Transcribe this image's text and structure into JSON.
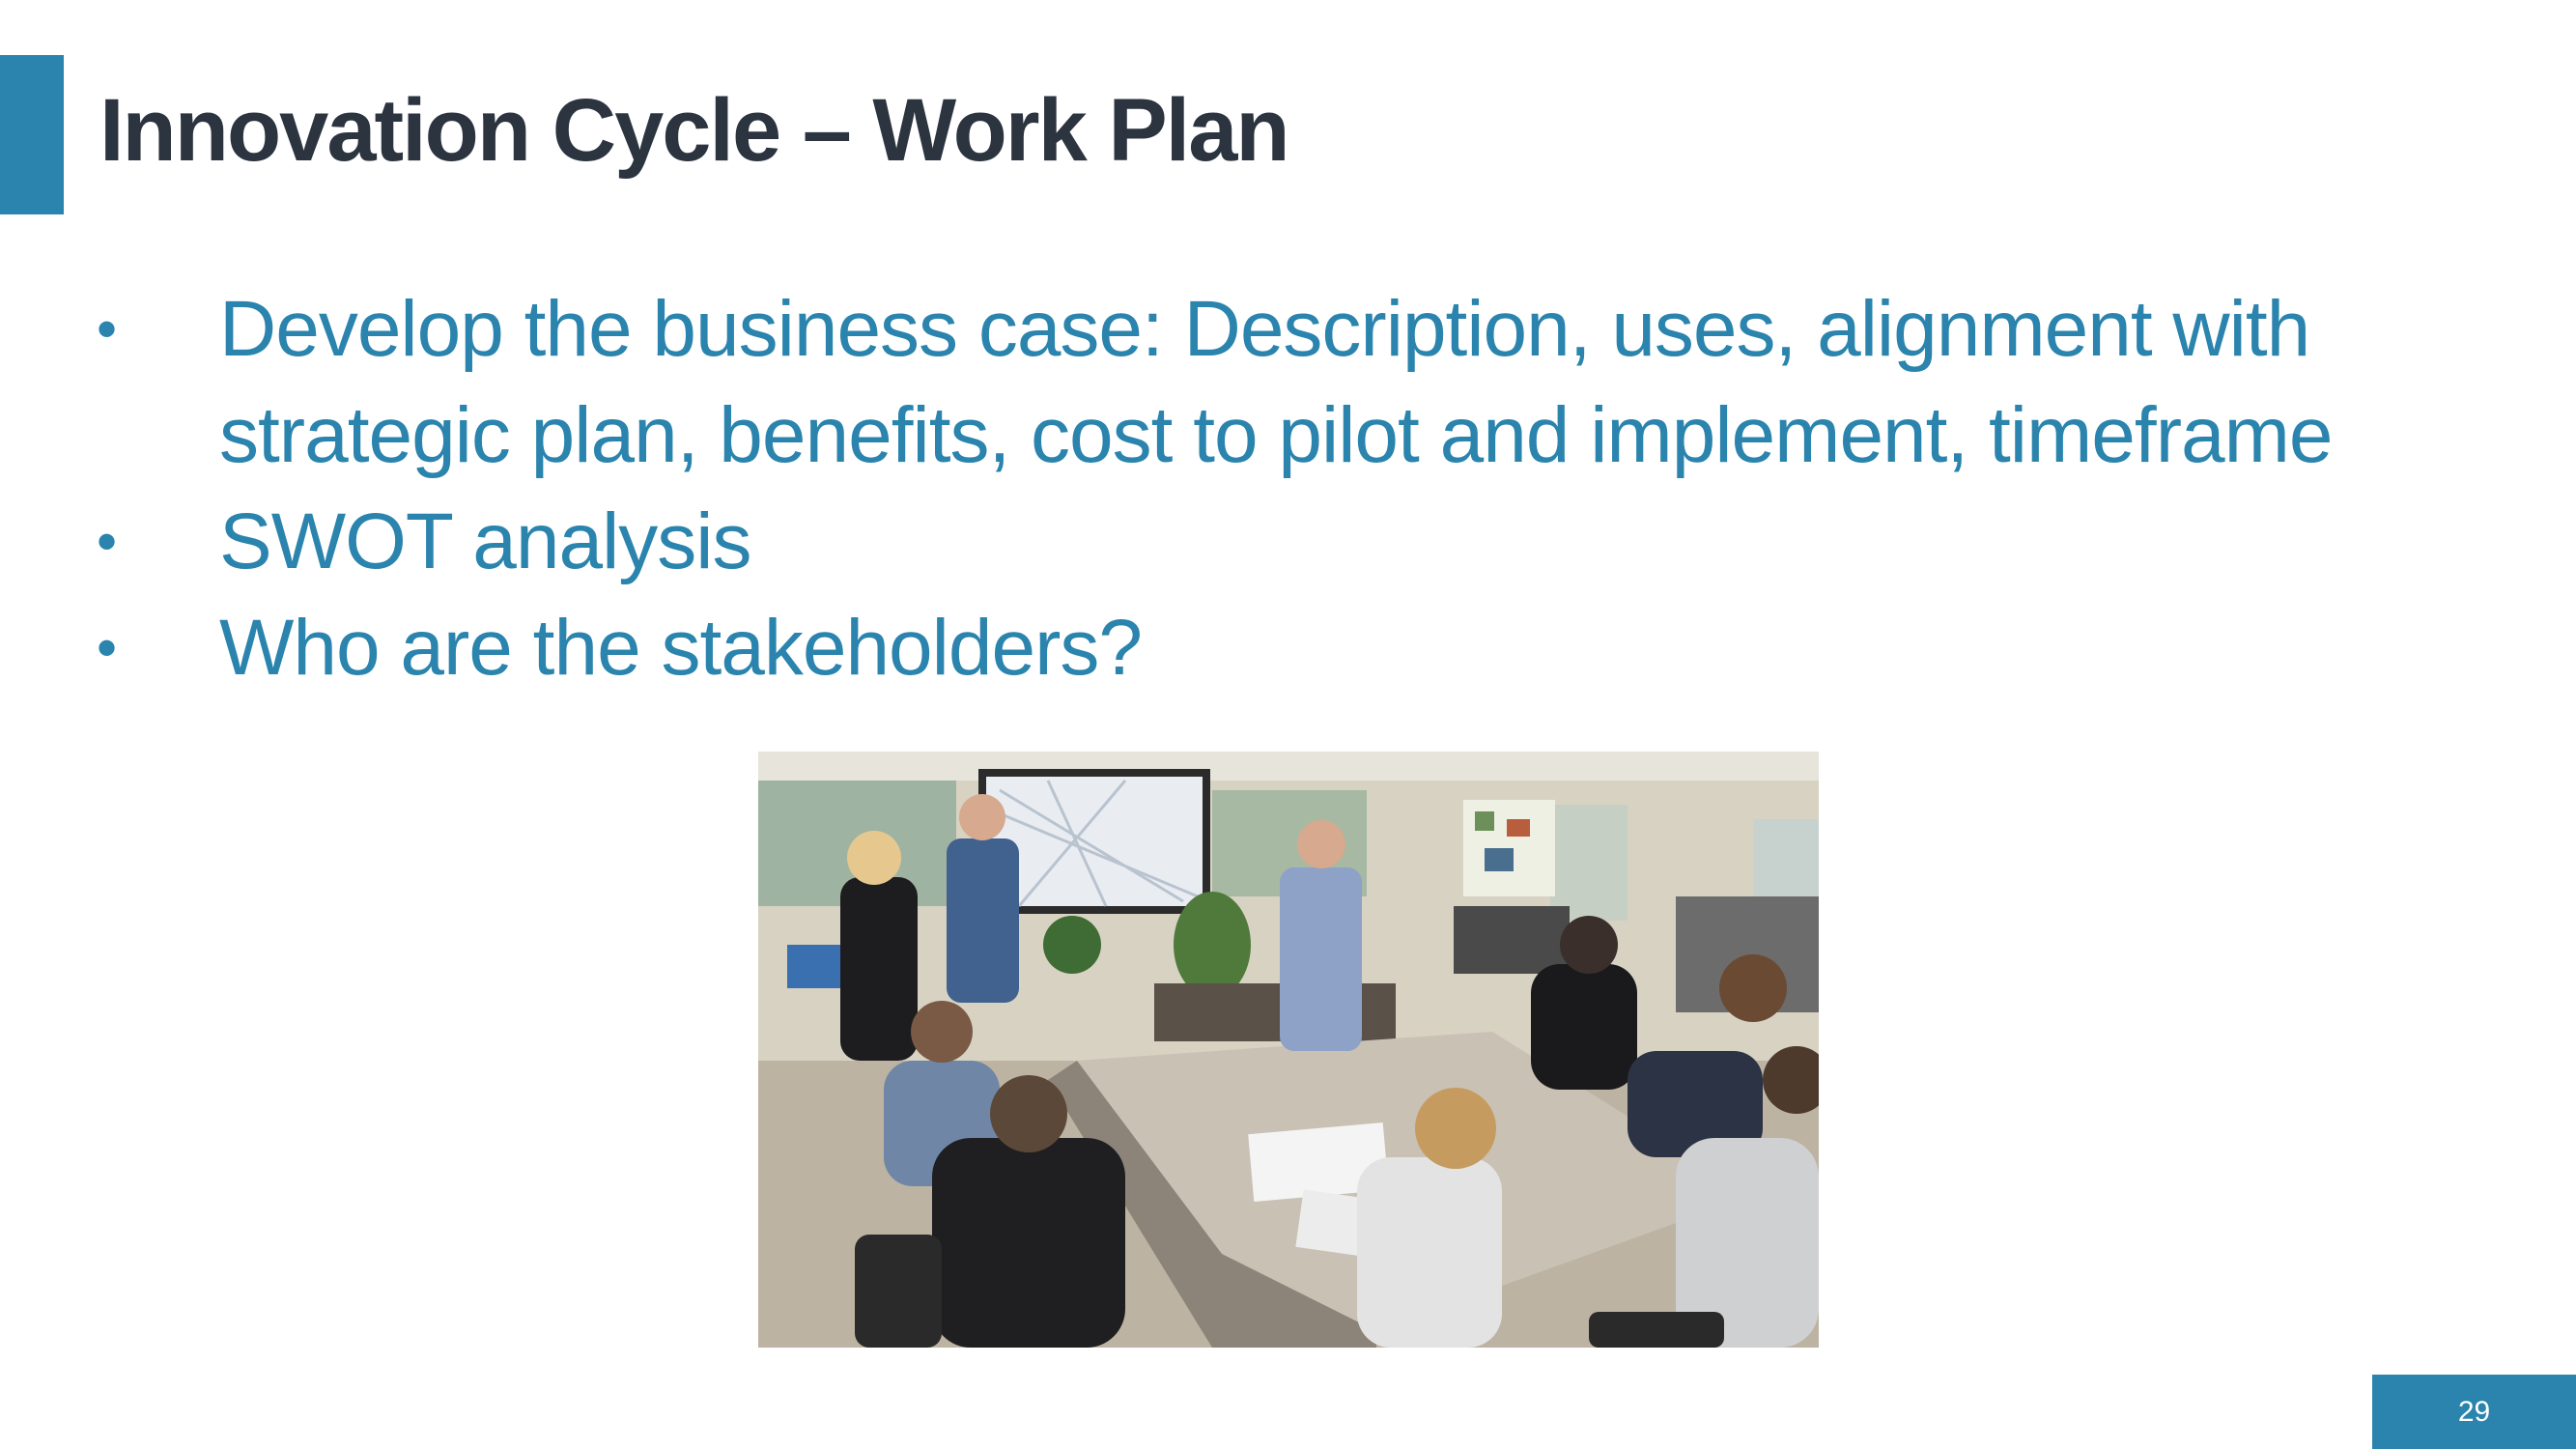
{
  "slide": {
    "title": "Innovation Cycle – Work Plan",
    "bullets": [
      "Develop the business case: Description, uses, alignment with strategic plan, benefits, cost to pilot and implement, timeframe",
      "SWOT analysis",
      "Who are the stakeholders?"
    ],
    "bullet_symbol": "•",
    "page_number": "29"
  },
  "photo": {
    "subject": "meeting-room-photo"
  },
  "colors": {
    "accent": "#2a84ad",
    "title_text": "#2c3440",
    "bullet_text": "#2a84ad",
    "background": "#ffffff"
  }
}
